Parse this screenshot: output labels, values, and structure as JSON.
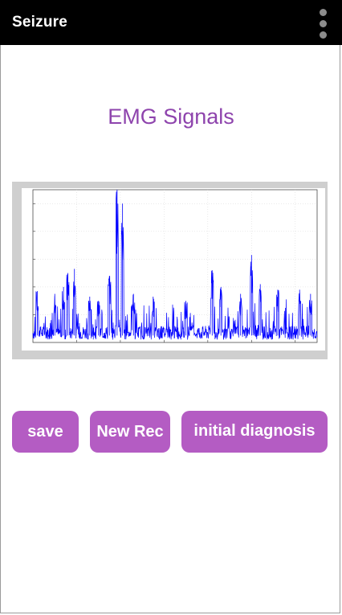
{
  "appbar": {
    "title": "Seizure",
    "menu_icon": "overflow-menu-icon"
  },
  "main": {
    "heading": "EMG Signals"
  },
  "chart_data": {
    "type": "line",
    "title": "",
    "xlabel": "",
    "ylabel": "",
    "xlim": [
      0,
      13
    ],
    "ylim": [
      0,
      1.1
    ],
    "grid": true,
    "series_color": "#0000ff",
    "x_ticks": [
      2,
      4,
      6,
      8,
      10,
      12
    ],
    "y_ticks": [
      0.2,
      0.4,
      0.6,
      0.8,
      1.0
    ],
    "peaks": [
      {
        "x": 0.2,
        "y": 0.37
      },
      {
        "x": 1.0,
        "y": 0.35
      },
      {
        "x": 1.4,
        "y": 0.4
      },
      {
        "x": 1.6,
        "y": 0.5
      },
      {
        "x": 1.9,
        "y": 0.53
      },
      {
        "x": 2.6,
        "y": 0.33
      },
      {
        "x": 3.0,
        "y": 0.3
      },
      {
        "x": 3.5,
        "y": 0.48
      },
      {
        "x": 3.85,
        "y": 1.1
      },
      {
        "x": 4.1,
        "y": 1.0
      },
      {
        "x": 4.6,
        "y": 0.35
      },
      {
        "x": 5.5,
        "y": 0.33
      },
      {
        "x": 7.0,
        "y": 0.3
      },
      {
        "x": 8.2,
        "y": 0.52
      },
      {
        "x": 8.6,
        "y": 0.4
      },
      {
        "x": 9.5,
        "y": 0.35
      },
      {
        "x": 10.0,
        "y": 0.63
      },
      {
        "x": 10.4,
        "y": 0.42
      },
      {
        "x": 11.2,
        "y": 0.38
      },
      {
        "x": 12.2,
        "y": 0.38
      },
      {
        "x": 12.7,
        "y": 0.35
      }
    ]
  },
  "buttons": {
    "save": "save",
    "new_rec": "New Rec",
    "initial_diagnosis": "initial diagnosis"
  }
}
